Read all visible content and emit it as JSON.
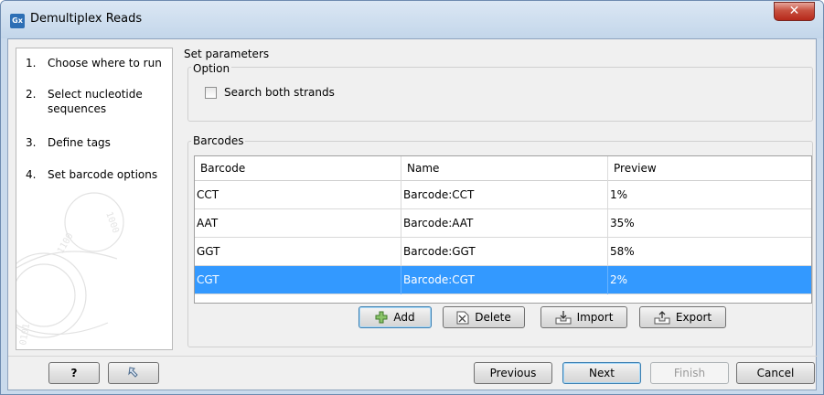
{
  "window": {
    "title": "Demultiplex Reads",
    "app_icon_text": "Gx",
    "close_glyph": "✕"
  },
  "steps": [
    {
      "num": "1.",
      "label": "Choose where to run"
    },
    {
      "num": "2.",
      "label": "Select nucleotide sequences"
    },
    {
      "num": "3.",
      "label": "Define tags"
    },
    {
      "num": "4.",
      "label": "Set barcode options"
    }
  ],
  "main": {
    "section_title": "Set parameters",
    "option_group": {
      "legend": "Option",
      "search_both_strands": {
        "label": "Search both strands",
        "checked": false
      }
    },
    "barcodes_group": {
      "legend": "Barcodes",
      "columns": [
        "Barcode",
        "Name",
        "Preview"
      ],
      "rows": [
        {
          "barcode": "CCT",
          "name": "Barcode:CCT",
          "preview": "1%"
        },
        {
          "barcode": "AAT",
          "name": "Barcode:AAT",
          "preview": "35%"
        },
        {
          "barcode": "GGT",
          "name": "Barcode:GGT",
          "preview": "58%"
        },
        {
          "barcode": "CGT",
          "name": "Barcode:CGT",
          "preview": "2%"
        }
      ],
      "selected_row": 3,
      "buttons": {
        "add": "Add",
        "delete": "Delete",
        "import": "Import",
        "export": "Export"
      }
    }
  },
  "footer": {
    "help_label": "?",
    "reset_icon": "reset-icon",
    "previous": "Previous",
    "next": "Next",
    "finish": "Finish",
    "cancel": "Cancel"
  },
  "colors": {
    "selection": "#3399ff",
    "close_button": "#c85140",
    "title_bar": "#c3d6ea"
  }
}
